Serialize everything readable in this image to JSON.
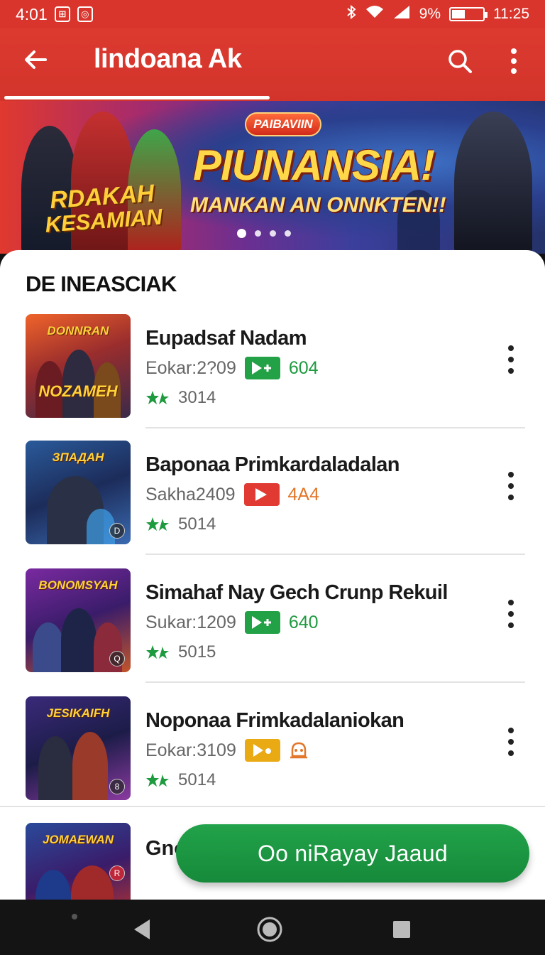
{
  "status_bar": {
    "time": "4:01",
    "battery_percent": "9%",
    "clock": "11:25",
    "icons": [
      "notification-icon",
      "app-icon",
      "bluetooth-icon",
      "wifi-icon",
      "signal-icon",
      "battery-icon"
    ]
  },
  "app_bar": {
    "title": "lindoana Ak",
    "icons": [
      "back-arrow-icon",
      "search-icon",
      "more-vert-icon"
    ]
  },
  "banner": {
    "chip": "PAIBAVIIN",
    "headline": "PIUNANSIA!",
    "subheadline": "MANKAN AN ONNKTEN!!",
    "logo_line1": "RDAKAH",
    "logo_line2": "KESAMIAN",
    "carousel_index": 0,
    "carousel_count": 4
  },
  "section": {
    "title": "DE INEASCIAK"
  },
  "games": [
    {
      "name": "Eupadsaf Nadam",
      "meta": "Eokar:2?09",
      "tag_color": "#22a146",
      "tag_icon": "play-plus-icon",
      "stat": "604",
      "stat_color": "#1e9a3f",
      "rating": "3014",
      "thumb_title": "DONNRAN",
      "thumb_title2": "NOZAMEH"
    },
    {
      "name": "Baponaa Primkardaladalan",
      "meta": "Sakha2409",
      "tag_color": "#e03a33",
      "tag_icon": "play-icon",
      "stat": "4A4",
      "stat_color": "#e2762a",
      "rating": "5014",
      "thumb_title": "ЗПАДАН",
      "thumb_badge": "D"
    },
    {
      "name": "Simahaf Nay Gech Crunp Rekuil",
      "meta": "Sukar:1209",
      "tag_color": "#22a146",
      "tag_icon": "play-plus-icon",
      "stat": "640",
      "stat_color": "#1e9a3f",
      "rating": "5015",
      "thumb_title": "BONOMSYAH",
      "thumb_badge": "Q"
    },
    {
      "name": "Noponaa Frimkadalaniokan",
      "meta": "Eokar:3109",
      "tag_color": "#e9aa14",
      "tag_icon": "play-dot-icon",
      "stat": "",
      "stat_color": "#e2762a",
      "rating": "5014",
      "thumb_title": "JESIKAIFH",
      "thumb_badge": "8"
    },
    {
      "name": "Gno",
      "thumb_title": "JOMAEWAN",
      "thumb_badge": "R"
    }
  ],
  "fab": {
    "label": "Oo niRayay Jaaud"
  },
  "nav_bar": {
    "icons": [
      "nav-back-icon",
      "nav-home-icon",
      "nav-recents-icon"
    ]
  }
}
